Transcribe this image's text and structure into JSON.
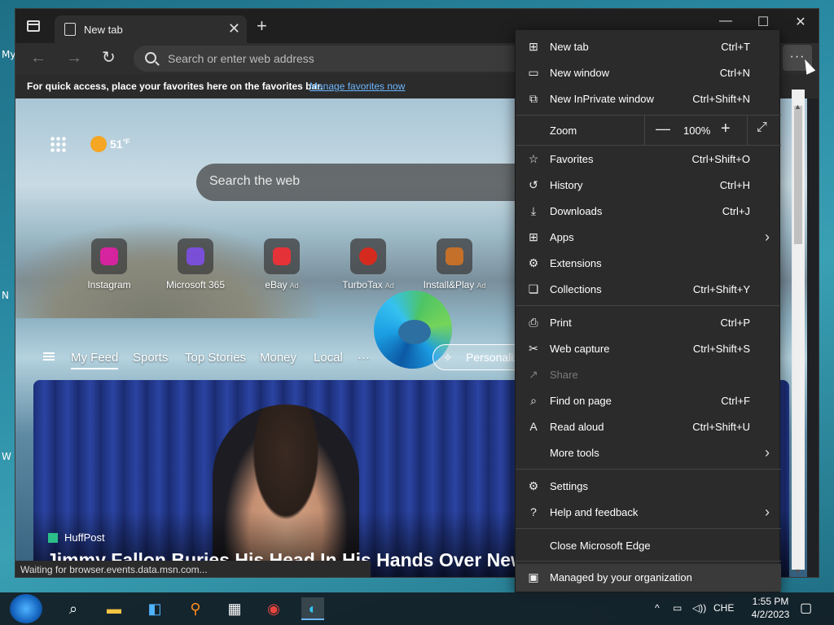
{
  "desktop": {
    "fragments": [
      "My",
      "N",
      "W"
    ]
  },
  "browser": {
    "tab": {
      "title": "New tab",
      "close_glyph": "✕"
    },
    "window_controls": {
      "minimize": "—",
      "maximize": "☐",
      "close": "✕"
    },
    "address_bar": {
      "placeholder": "Search or enter web address",
      "more_glyph": "···"
    },
    "favorites_bar": {
      "text": "For quick access, place your favorites here on the favorites bar.",
      "link": "Manage favorites now"
    },
    "status": "Waiting for browser.events.data.msn.com..."
  },
  "newtab": {
    "weather": {
      "temp": "51",
      "unit": "°F"
    },
    "search_placeholder": "Search the web",
    "quicklinks": [
      {
        "label": "Instagram",
        "ad": "",
        "color": "#d6249f"
      },
      {
        "label": "Microsoft 365",
        "ad": "",
        "color": "#7a4fd8"
      },
      {
        "label": "eBay",
        "ad": "Ad",
        "color": "#e53238"
      },
      {
        "label": "TurboTax",
        "ad": "Ad",
        "color": "#d52b1e"
      },
      {
        "label": "Install&Play",
        "ad": "Ad",
        "color": "#c4702a"
      }
    ],
    "feed_tabs": [
      "My Feed",
      "Sports",
      "Top Stories",
      "Money",
      "Local",
      "···"
    ],
    "personalize": "Personaliz",
    "article": {
      "publisher": "HuffPost",
      "headline": "Jimmy Fallon Buries His Head In His Hands Over New"
    }
  },
  "menu": {
    "items": [
      {
        "icon": "new-tab-icon",
        "glyph": "⊞",
        "label": "New tab",
        "shortcut": "Ctrl+T"
      },
      {
        "icon": "new-window-icon",
        "glyph": "▭",
        "label": "New window",
        "shortcut": "Ctrl+N"
      },
      {
        "icon": "inprivate-icon",
        "glyph": "⧉",
        "label": "New InPrivate window",
        "shortcut": "Ctrl+Shift+N"
      },
      {
        "label": "Zoom",
        "value": "100%"
      },
      {
        "icon": "favorites-icon",
        "glyph": "☆",
        "label": "Favorites",
        "shortcut": "Ctrl+Shift+O"
      },
      {
        "icon": "history-icon",
        "glyph": "↺",
        "label": "History",
        "shortcut": "Ctrl+H"
      },
      {
        "icon": "downloads-icon",
        "glyph": "⤓",
        "label": "Downloads",
        "shortcut": "Ctrl+J"
      },
      {
        "icon": "apps-icon",
        "glyph": "⊞",
        "label": "Apps",
        "shortcut": ""
      },
      {
        "icon": "extensions-icon",
        "glyph": "⚙",
        "label": "Extensions",
        "shortcut": ""
      },
      {
        "icon": "collections-icon",
        "glyph": "❏",
        "label": "Collections",
        "shortcut": "Ctrl+Shift+Y"
      },
      {
        "icon": "print-icon",
        "glyph": "⎙",
        "label": "Print",
        "shortcut": "Ctrl+P"
      },
      {
        "icon": "web-capture-icon",
        "glyph": "✂",
        "label": "Web capture",
        "shortcut": "Ctrl+Shift+S"
      },
      {
        "icon": "share-icon",
        "glyph": "↗",
        "label": "Share",
        "shortcut": ""
      },
      {
        "icon": "find-icon",
        "glyph": "⌕",
        "label": "Find on page",
        "shortcut": "Ctrl+F"
      },
      {
        "icon": "read-aloud-icon",
        "glyph": "A",
        "label": "Read aloud",
        "shortcut": "Ctrl+Shift+U"
      },
      {
        "label": "More tools"
      },
      {
        "icon": "settings-icon",
        "glyph": "⚙",
        "label": "Settings"
      },
      {
        "icon": "help-icon",
        "glyph": "?",
        "label": "Help and feedback"
      },
      {
        "label": "Close Microsoft Edge"
      },
      {
        "icon": "briefcase-icon",
        "glyph": "▣",
        "label": "Managed by your organization"
      }
    ],
    "chevron": "›",
    "zoom_minus": "—",
    "zoom_plus": "+",
    "zoom_full": "⤢"
  },
  "taskbar": {
    "language": "CHE",
    "time": "1:55 PM",
    "date": "4/2/2023"
  }
}
